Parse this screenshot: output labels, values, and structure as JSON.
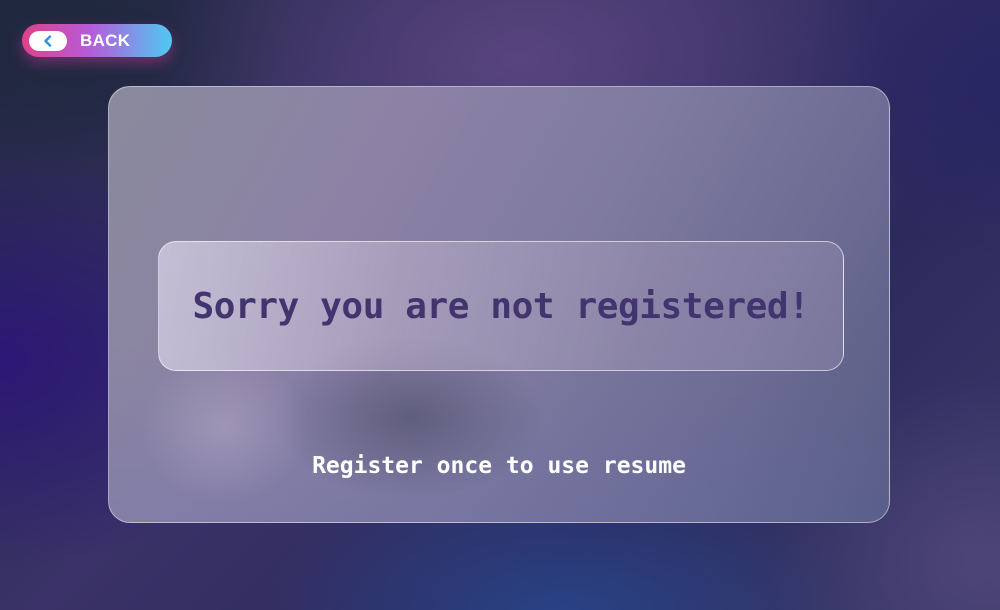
{
  "back_button": {
    "label": "BACK",
    "icon": "chevron-left-icon"
  },
  "card": {
    "message": "Sorry you are not registered!",
    "subtext": "Register once to use resume"
  },
  "colors": {
    "back_gradient_start": "#e0418a",
    "back_gradient_end": "#4fc9f2",
    "message_text": "#42346e",
    "subtext": "#ffffff"
  }
}
